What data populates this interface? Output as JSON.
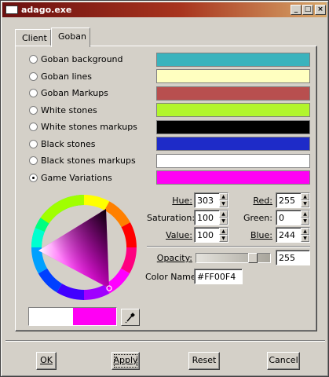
{
  "window": {
    "title": "adago.exe",
    "buttons": {
      "minimize": "_",
      "maximize": "□",
      "close": "×"
    }
  },
  "tabs": [
    {
      "label": "Client",
      "active": false
    },
    {
      "label": "Goban",
      "active": true
    }
  ],
  "options": [
    {
      "label": "Goban background",
      "color": "#3ab3bd",
      "selected": false
    },
    {
      "label": "Goban lines",
      "color": "#ffffc0",
      "selected": false
    },
    {
      "label": "Goban Markups",
      "color": "#b84f4f",
      "selected": false
    },
    {
      "label": "White stones",
      "color": "#b2f52c",
      "selected": false
    },
    {
      "label": "White stones markups",
      "color": "#000000",
      "selected": false
    },
    {
      "label": "Black stones",
      "color": "#1e2bc8",
      "selected": false
    },
    {
      "label": "Black stones markups",
      "color": "#ffffff",
      "selected": false
    },
    {
      "label": "Game Variations",
      "color": "#ff00f4",
      "selected": true
    }
  ],
  "hsv": {
    "hue_label": "Hue:",
    "hue": "303",
    "saturation_label": "Saturation:",
    "saturation": "100",
    "value_label": "Value:",
    "value": "100"
  },
  "rgb": {
    "red_label": "Red:",
    "red": "255",
    "green_label": "Green:",
    "green": "0",
    "blue_label": "Blue:",
    "blue": "244"
  },
  "opacity": {
    "label": "Opacity:",
    "value": "255",
    "fraction": 1.0
  },
  "color_name": {
    "label": "Color Name:",
    "value": "#FF00F4"
  },
  "preview": {
    "old_color": "#ffffff",
    "new_color": "#ff00f4"
  },
  "actions": {
    "ok": "OK",
    "apply": "Apply",
    "reset": "Reset",
    "cancel": "Cancel"
  },
  "icons": {
    "picker": "eyedropper-icon",
    "wheel": "color-wheel-icon"
  }
}
